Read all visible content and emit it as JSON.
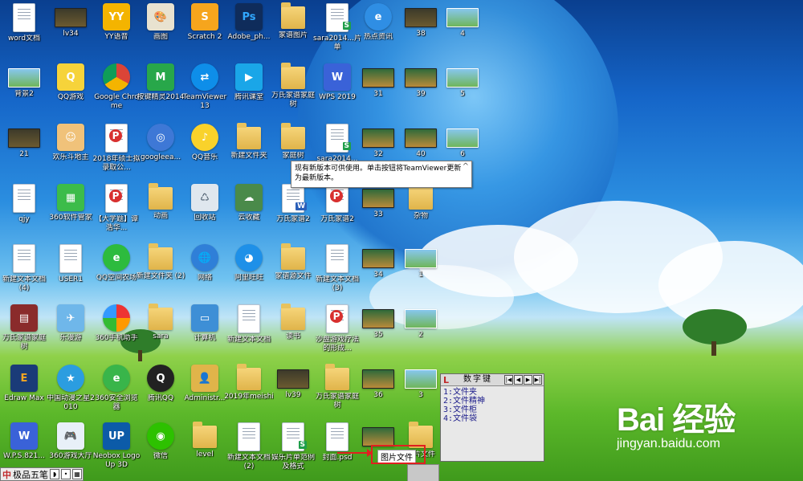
{
  "desktop": {
    "icons": [
      {
        "label": "word文档",
        "kind": "doc"
      },
      {
        "label": "lv34",
        "kind": "thumb"
      },
      {
        "label": "YY语音",
        "kind": "yy"
      },
      {
        "label": "画图",
        "kind": "paint"
      },
      {
        "label": "Scratch 2",
        "kind": "scratch"
      },
      {
        "label": "Adobe_ph...",
        "kind": "ps"
      },
      {
        "label": "家谱图片",
        "kind": "folder"
      },
      {
        "label": "sara2014...片单",
        "kind": "docs"
      },
      {
        "label": "热点资讯",
        "kind": "ie"
      },
      {
        "label": "38",
        "kind": "thumb"
      },
      {
        "label": "4",
        "kind": "thumbgreen"
      },
      {
        "label": "背景2",
        "kind": "thumbgreen"
      },
      {
        "label": "QQ游戏",
        "kind": "qqgame"
      },
      {
        "label": "Google Chrome",
        "kind": "chrome"
      },
      {
        "label": "按键精灵2014",
        "kind": "keysprite"
      },
      {
        "label": "TeamViewer 13",
        "kind": "teamviewer"
      },
      {
        "label": "腾讯课堂",
        "kind": "txclass"
      },
      {
        "label": "万氏家谱家庭树",
        "kind": "folder"
      },
      {
        "label": "WPS 2019",
        "kind": "wps"
      },
      {
        "label": "31",
        "kind": "thumbgame"
      },
      {
        "label": "39",
        "kind": "thumbgame"
      },
      {
        "label": "5",
        "kind": "thumbgreen"
      },
      {
        "label": "21",
        "kind": "thumb"
      },
      {
        "label": "欢乐斗地主",
        "kind": "ddz"
      },
      {
        "label": "2018年硕士拟录取公...",
        "kind": "docp"
      },
      {
        "label": "googleea...",
        "kind": "earth"
      },
      {
        "label": "QQ音乐",
        "kind": "qqmusic"
      },
      {
        "label": "新建文件夹",
        "kind": "folder"
      },
      {
        "label": "家庭树",
        "kind": "folder"
      },
      {
        "label": "sara2014...",
        "kind": "docs"
      },
      {
        "label": "32",
        "kind": "thumbgame"
      },
      {
        "label": "40",
        "kind": "thumbgame"
      },
      {
        "label": "6",
        "kind": "thumbgreen"
      },
      {
        "label": "qjy",
        "kind": "doc"
      },
      {
        "label": "360软件管家",
        "kind": "soft360"
      },
      {
        "label": "【大学题】谭浩华...",
        "kind": "docp"
      },
      {
        "label": "动画",
        "kind": "folder"
      },
      {
        "label": "回收站",
        "kind": "recycle"
      },
      {
        "label": "云收藏",
        "kind": "cloud"
      },
      {
        "label": "万氏家谱2",
        "kind": "docw"
      },
      {
        "label": "万氏家谱2",
        "kind": "docp"
      },
      {
        "label": "33",
        "kind": "thumbgame"
      },
      {
        "label": "杂物",
        "kind": "folder"
      },
      {
        "label": "新建文本文档 (4)",
        "kind": "doc"
      },
      {
        "label": "USER1",
        "kind": "doc"
      },
      {
        "label": "QQ空间农场",
        "kind": "farm"
      },
      {
        "label": "新建文件夹 (2)",
        "kind": "folder"
      },
      {
        "label": "网络",
        "kind": "network"
      },
      {
        "label": "阿里旺旺",
        "kind": "wangwang"
      },
      {
        "label": "家谱源文件",
        "kind": "folder"
      },
      {
        "label": "新建文本文档 (3)",
        "kind": "doc"
      },
      {
        "label": "34",
        "kind": "thumbgame"
      },
      {
        "label": "1",
        "kind": "thumbgreen"
      },
      {
        "label": "万氏家谱家庭树",
        "kind": "winrar"
      },
      {
        "label": "乐漫游",
        "kind": "lemanyou"
      },
      {
        "label": "360手机助手",
        "kind": "phone360"
      },
      {
        "label": "sara",
        "kind": "folder"
      },
      {
        "label": "计算机",
        "kind": "computer"
      },
      {
        "label": "新建文本文档",
        "kind": "doc"
      },
      {
        "label": "读书",
        "kind": "folder"
      },
      {
        "label": "沙盘游戏疗法的形成...",
        "kind": "docp"
      },
      {
        "label": "35",
        "kind": "thumbgame"
      },
      {
        "label": "2",
        "kind": "thumbgreen"
      },
      {
        "label": "Edraw Max",
        "kind": "edraw"
      },
      {
        "label": "中国动漫之星2010",
        "kind": "star"
      },
      {
        "label": "360安全浏览器",
        "kind": "browser360"
      },
      {
        "label": "腾讯QQ",
        "kind": "qq"
      },
      {
        "label": "Administr...",
        "kind": "admin"
      },
      {
        "label": "2019年meishi",
        "kind": "folder"
      },
      {
        "label": "lv39",
        "kind": "thumb"
      },
      {
        "label": "万氏家谱家庭树",
        "kind": "folder"
      },
      {
        "label": "36",
        "kind": "thumbgame"
      },
      {
        "label": "3",
        "kind": "thumbgreen"
      },
      {
        "label": "W.P.S.821...",
        "kind": "wps"
      },
      {
        "label": "360游戏大厅",
        "kind": "game360"
      },
      {
        "label": "Neobox LogoUp 3D",
        "kind": "neobox"
      },
      {
        "label": "微信",
        "kind": "wechat"
      },
      {
        "label": "level",
        "kind": "folder"
      },
      {
        "label": "新建文本文档 (2)",
        "kind": "doc"
      },
      {
        "label": "娱乐片单范例及格式",
        "kind": "docs"
      },
      {
        "label": "封面.psd",
        "kind": "doc"
      },
      {
        "label": "",
        "kind": "thumbgame"
      },
      {
        "label": "图片文件",
        "kind": "folder"
      }
    ]
  },
  "tooltip": {
    "text": "现有新版本可供使用。单击按钮将TeamViewer更新为最新版本。",
    "close": "^"
  },
  "ime_panel": {
    "logo": "L",
    "title": "数字键",
    "nav": [
      "|◀",
      "◀",
      "▶",
      "▶|"
    ],
    "candidates": [
      "1:文件夹",
      "2:文件精神",
      "3:文件柜",
      "4:文件袋"
    ]
  },
  "ime_status": {
    "mode": "中",
    "name": "极品五笔",
    "btns": [
      "◗",
      "•",
      "▦"
    ]
  },
  "highlight_label": "图片文件",
  "watermark": {
    "brand": "Bai 经验",
    "url": "jingyan.baidu.com"
  },
  "colors": {
    "highlight": "#e02020",
    "ime_candidate": "#1a1a8a"
  }
}
